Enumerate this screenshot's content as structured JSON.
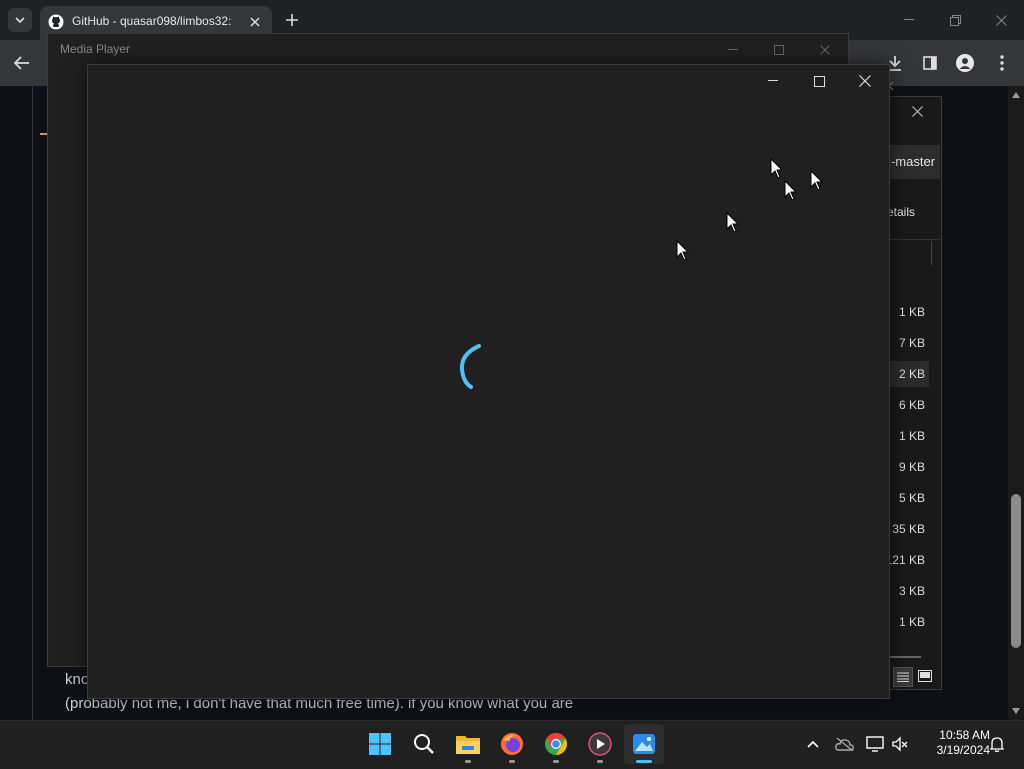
{
  "browser": {
    "tab_title": "GitHub - quasar098/limbos32:",
    "page_text_line1": "kno",
    "page_text_line2": "(probably not me, i don't have that much free time). if you know what you are"
  },
  "explorer": {
    "folder_label": "-master",
    "view_label": "etails",
    "sizes": [
      "1 KB",
      "7 KB",
      "2 KB",
      "6 KB",
      "1 KB",
      "9 KB",
      "5 KB",
      "35 KB",
      "121 KB",
      "3 KB",
      "1 KB"
    ]
  },
  "media_player_back": {
    "title": "Media Player"
  },
  "taskbar": {
    "time": "10:58 AM",
    "date": "3/19/2024"
  },
  "colors": {
    "spinner": "#4cc2ff",
    "taskbar_active": "#4cc2ff"
  }
}
